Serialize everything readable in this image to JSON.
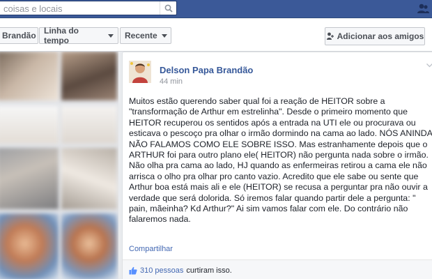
{
  "search": {
    "placeholder": "coisas e locais"
  },
  "nav": {
    "profile_name": "Brandão",
    "timeline_label": "Linha do tempo",
    "recent_label": "Recente",
    "add_friend_label": "Adicionar aos amigos"
  },
  "post": {
    "author": "Delson Papa Brandão",
    "time": "44 min",
    "text": "Muitos estão querendo saber qual foi a reação de HEITOR sobre a \"transformação de Arthur em estrelinha\". Desde o primeiro momento que HEITOR recuperou os sentidos após a entrada na UTI ele ou procurava ou esticava o pescoço pra olhar o irmão dormindo na cama ao lado. NÓS ANINDA NÃO FALAMOS COMO ELE SOBRE ISSO. Mas estranhamente depois que o ARTHUR foi para outro plano ele( HEITOR) não pergunta nada sobre o irmão. Não olha pra cama ao lado, HJ quando as enfermeiras retirou a cama ele não arrisca o olho pra olhar pro canto vazio. Acredito que ele sabe ou sente que Arthur boa está mais ali e ele (HEITOR) se recusa a perguntar pra não ouvir a verdade que será dolorida. Só iremos falar quando partir dele a pergunta: \" pain, mãeinha? Kd Arthur?\" Ai sim vamos falar com ele. Do contrário não falaremos nada.",
    "share_label": "Compartilhar",
    "likes_count": "310 pessoas",
    "likes_suffix": " curtiram isso."
  },
  "icons": {
    "search": "search-icon",
    "topbar": "friend-requests-icon",
    "add_friend": "add-friend-icon",
    "chevron": "chevron-down-icon",
    "like": "thumbs-up-icon"
  },
  "colors": {
    "brand": "#3b5998",
    "link": "#365899",
    "page_bg": "#e9ebee"
  }
}
